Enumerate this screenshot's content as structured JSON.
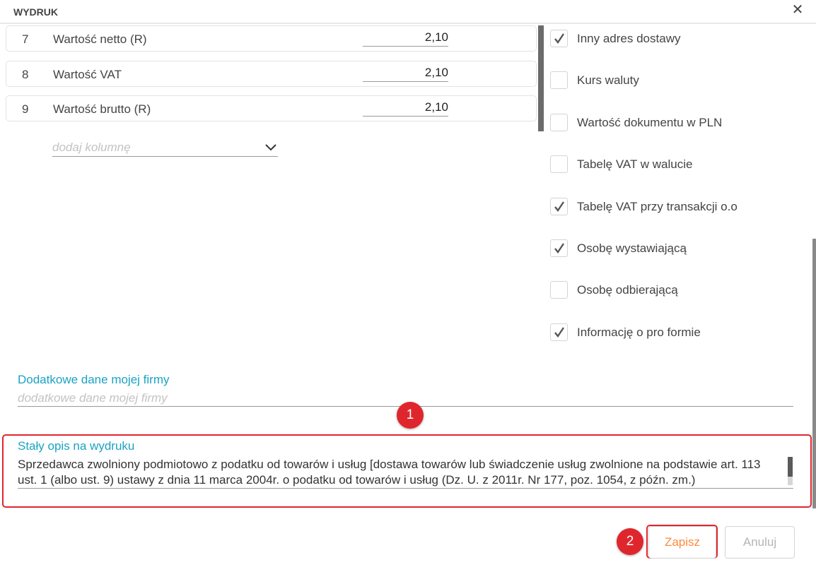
{
  "dialog": {
    "title": "WYDRUK",
    "close_icon": "close-icon"
  },
  "columns": [
    {
      "num": "7",
      "label": "Wartość netto (R)",
      "value": "2,10"
    },
    {
      "num": "8",
      "label": "Wartość VAT",
      "value": "2,10"
    },
    {
      "num": "9",
      "label": "Wartość brutto (R)",
      "value": "2,10"
    }
  ],
  "add_column": {
    "placeholder": "dodaj kolumnę",
    "icon": "chevron-down-icon"
  },
  "options": [
    {
      "label": "Inny adres dostawy",
      "checked": true
    },
    {
      "label": "Kurs waluty",
      "checked": false
    },
    {
      "label": "Wartość dokumentu w PLN",
      "checked": false
    },
    {
      "label": "Tabelę VAT w walucie",
      "checked": false
    },
    {
      "label": "Tabelę VAT przy transakcji o.o",
      "checked": true
    },
    {
      "label": "Osobę wystawiającą",
      "checked": true
    },
    {
      "label": "Osobę odbierającą",
      "checked": false
    },
    {
      "label": "Informację o pro formie",
      "checked": true
    }
  ],
  "extra_company": {
    "label": "Dodatkowe dane mojej firmy",
    "placeholder": "dodatkowe dane mojej firmy"
  },
  "fixed_description": {
    "label": "Stały opis na wydruku",
    "value": "Sprzedawca zwolniony podmiotowo z podatku od towarów i usług [dostawa towarów lub świadczenie usług zwolnione na podstawie art. 113 ust. 1 (albo ust. 9) ustawy z dnia 11 marca 2004r. o podatku od towarów i usług (Dz. U. z 2011r. Nr 177, poz. 1054, z późn. zm.)"
  },
  "annotations": {
    "badge1": "1",
    "badge2": "2"
  },
  "buttons": {
    "save": "Zapisz",
    "cancel": "Anuluj"
  },
  "colors": {
    "accent": "#1aa3c4",
    "save_text": "#ff8a3d",
    "highlight": "#e0262d",
    "disabled_text": "#b5b5b5"
  }
}
